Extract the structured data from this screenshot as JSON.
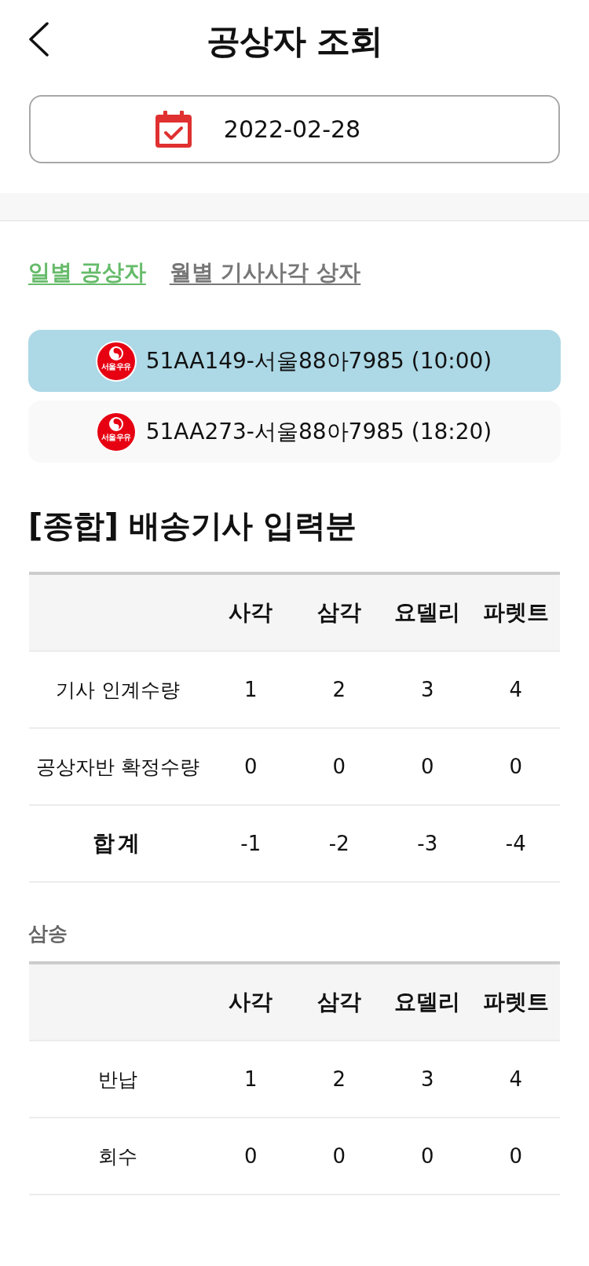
{
  "header": {
    "title": "공상자 조회"
  },
  "date_picker": {
    "value": "2022-02-28"
  },
  "tabs": [
    {
      "label": "일별 공상자",
      "selected": true
    },
    {
      "label": "월별 기사사각 상자",
      "selected": false
    }
  ],
  "trucks": [
    {
      "logo_text": "서울우유",
      "label": "51AA149-서울88아7985 (10:00)",
      "selected": true
    },
    {
      "logo_text": "서울우유",
      "label": "51AA273-서울88아7985 (18:20)",
      "selected": false
    }
  ],
  "sections": [
    {
      "kind": "main",
      "title": "[종합] 배송기사 입력분",
      "table": {
        "columns": [
          "사각",
          "삼각",
          "요델리",
          "파렛트"
        ],
        "rows": [
          {
            "kind": "data",
            "label": "기사 인계수량",
            "cells": [
              "1",
              "2",
              "3",
              "4"
            ]
          },
          {
            "kind": "data",
            "label": "공상자반 확정수량",
            "cells": [
              "0",
              "0",
              "0",
              "0"
            ]
          },
          {
            "kind": "total",
            "label": "합계",
            "cells": [
              "-1",
              "-2",
              "-3",
              "-4"
            ]
          }
        ]
      }
    },
    {
      "kind": "sub",
      "title": "삼송",
      "table": {
        "columns": [
          "사각",
          "삼각",
          "요델리",
          "파렛트"
        ],
        "rows": [
          {
            "kind": "data",
            "label": "반납",
            "cells": [
              "1",
              "2",
              "3",
              "4"
            ]
          },
          {
            "kind": "data",
            "label": "회수",
            "cells": [
              "0",
              "0",
              "0",
              "0"
            ]
          }
        ]
      }
    }
  ]
}
